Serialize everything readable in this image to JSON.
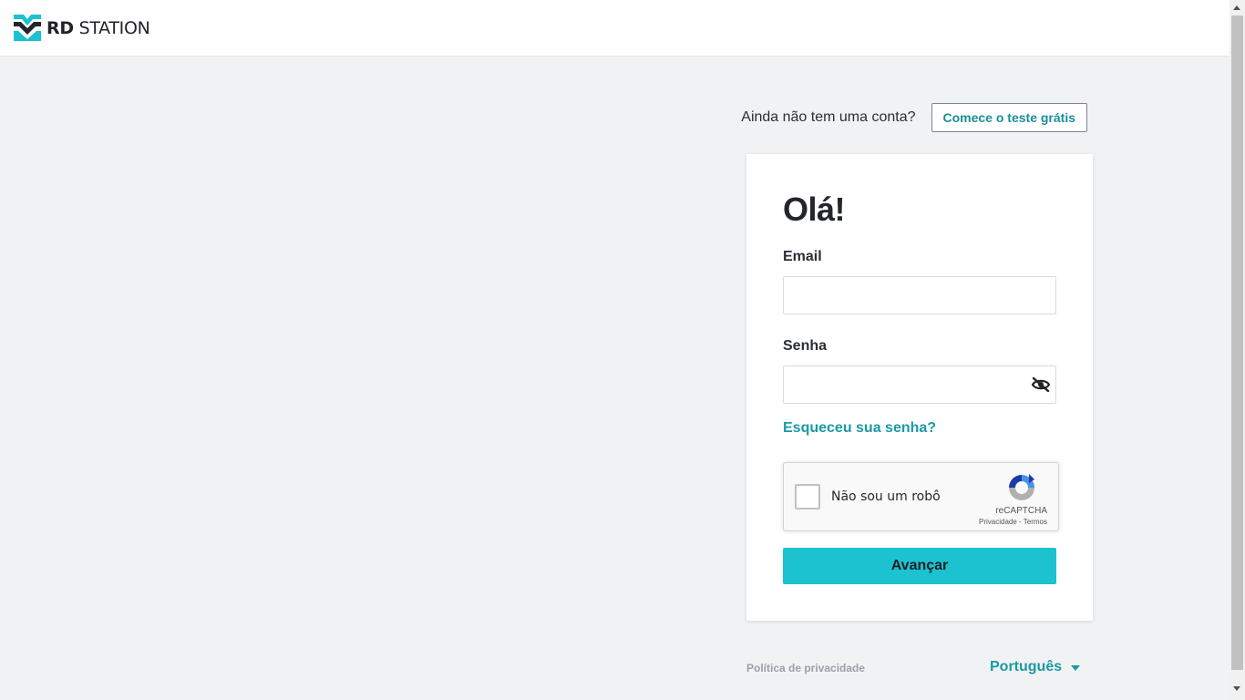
{
  "header": {
    "logo_bold": "RD",
    "logo_rest": "STATION"
  },
  "signup": {
    "prompt": "Ainda não tem uma conta?",
    "button_label": "Comece o teste grátis"
  },
  "login_form": {
    "title": "Olá!",
    "email_label": "Email",
    "email_value": "",
    "password_label": "Senha",
    "password_value": "",
    "forgot_label": "Esqueceu sua senha?",
    "submit_label": "Avançar"
  },
  "recaptcha": {
    "label": "Não sou um robô",
    "brand": "reCAPTCHA",
    "privacy": "Privacidade",
    "separator": " - ",
    "terms": "Termos"
  },
  "footer": {
    "privacy_label": "Política de privacidade",
    "language_label": "Português"
  },
  "colors": {
    "accent": "#1cc2cf",
    "link": "#1b9aa5",
    "background": "#f1f2f4"
  },
  "icons": {
    "password_toggle": "eye-off-icon",
    "language_dropdown": "caret-down-icon",
    "captcha": "recaptcha-logo-icon"
  }
}
